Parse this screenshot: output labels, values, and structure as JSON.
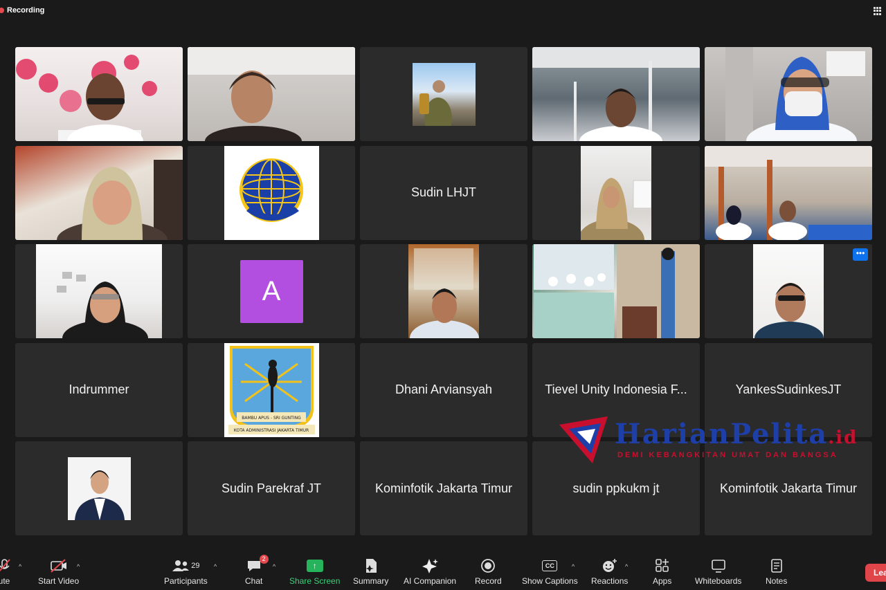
{
  "topbar": {
    "recording_label": "Recording"
  },
  "tiles": [
    {
      "name": "",
      "kind": "video"
    },
    {
      "name": "",
      "kind": "video",
      "speaking": true
    },
    {
      "name": "",
      "kind": "picture"
    },
    {
      "name": "",
      "kind": "video"
    },
    {
      "name": "",
      "kind": "video"
    },
    {
      "name": "",
      "kind": "video"
    },
    {
      "name": "",
      "kind": "logo"
    },
    {
      "name": "Sudin LHJT",
      "kind": "name"
    },
    {
      "name": "",
      "kind": "video"
    },
    {
      "name": "",
      "kind": "video"
    },
    {
      "name": "",
      "kind": "video"
    },
    {
      "name": "A",
      "kind": "avatar-letter"
    },
    {
      "name": "",
      "kind": "video"
    },
    {
      "name": "",
      "kind": "video"
    },
    {
      "name": "",
      "kind": "video"
    },
    {
      "name": "Indrummer",
      "kind": "name"
    },
    {
      "name": "",
      "kind": "logo"
    },
    {
      "name": "Dhani Arviansyah",
      "kind": "name"
    },
    {
      "name": "Tievel Unity Indonesia F...",
      "kind": "name"
    },
    {
      "name": "YankesSudinkesJT",
      "kind": "name"
    },
    {
      "name": "",
      "kind": "picture"
    },
    {
      "name": "Sudin Parekraf JT",
      "kind": "name"
    },
    {
      "name": "Kominfotik Jakarta Timur",
      "kind": "name"
    },
    {
      "name": "sudin ppkukm jt",
      "kind": "name"
    },
    {
      "name": "Kominfotik Jakarta Timur",
      "kind": "name"
    }
  ],
  "logo_text": {
    "seal_motto": "BAMBU APUS - SRI GUNTING",
    "seal_city": "KOTA ADMINISTRASI JAKARTA TIMUR"
  },
  "tile_menu_glyph": "•••",
  "watermark": {
    "brand": "HarianPelita",
    "tld": ".id",
    "tagline": "DEMI KEBANGKITAN UMAT DAN BANGSA"
  },
  "toolbar": {
    "mute": "ute",
    "start_video": "Start Video",
    "participants": "Participants",
    "participants_count": "29",
    "chat": "Chat",
    "chat_badge": "2",
    "share_screen": "Share Screen",
    "summary": "Summary",
    "ai_companion": "AI Companion",
    "record": "Record",
    "show_captions": "Show Captions",
    "captions_icon_text": "CC",
    "reactions": "Reactions",
    "apps": "Apps",
    "whiteboards": "Whiteboards",
    "notes": "Notes",
    "leave": "Leave"
  },
  "colors": {
    "background": "#1a1a1a",
    "tile": "#2b2b2b",
    "speaking_outline": "#7ed957",
    "share_green": "#25b35b",
    "leave_red": "#e0454a",
    "avatar_purple": "#b34fe0",
    "accent_blue": "#0e72ed"
  }
}
